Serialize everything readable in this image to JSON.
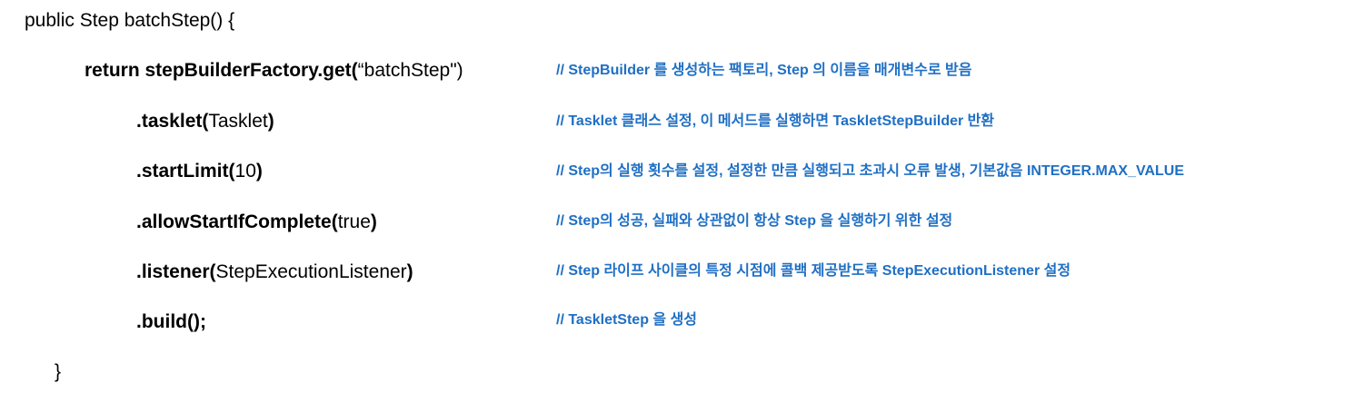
{
  "signature": "public Step batchStep() {",
  "lines": [
    {
      "bold": "return stepBuilderFactory.get(",
      "normal": "“batchStep\")",
      "tail": "",
      "comment": "// StepBuilder 를 생성하는 팩토리,  Step 의 이름을 매개변수로 받음"
    },
    {
      "bold": ".tasklet(",
      "normal": "Tasklet",
      "tail": ")",
      "comment": "// Tasklet 클래스 설정, 이 메서드를 실행하면 TaskletStepBuilder 반환"
    },
    {
      "bold": ".startLimit(",
      "normal": "10",
      "tail": ")",
      "comment": "// Step의 실행 횟수를 설정, 설정한 만큼 실행되고 초과시 오류 발생, 기본값음 INTEGER.MAX_VALUE"
    },
    {
      "bold": ".allowStartIfComplete(",
      "normal": "true",
      "tail": ")",
      "comment": "// Step의 성공, 실패와 상관없이 항상 Step 을 실행하기 위한 설정"
    },
    {
      "bold": ".listener(",
      "normal": "StepExecutionListener",
      "tail": ")",
      "comment": "// Step 라이프 사이클의 특정 시점에 콜백 제공받도록 StepExecutionListener 설정"
    },
    {
      "bold": ".build();",
      "normal": "",
      "tail": "",
      "comment": "// TaskletStep 을 생성"
    }
  ],
  "closing": "}",
  "colors": {
    "comment": "#1f6fc4",
    "code": "#000000"
  }
}
